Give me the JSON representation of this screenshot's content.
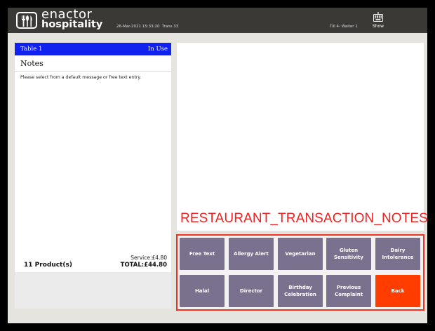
{
  "topbar": {
    "logo_top": "enactor",
    "logo_bottom": "hospitality",
    "date": "26-Mar-2021 15:33:20",
    "trans": "Trans 33",
    "till": "Till 4- Waiter 1",
    "show_label": "Show"
  },
  "left_panel": {
    "table_name": "Table 1",
    "table_status": "In Use",
    "notes_title": "Notes",
    "notes_message": "Please select from a default message or free text entry.",
    "service": "Service:£4.80",
    "products": "11 Product(s)",
    "total": "TOTAL:£44.80"
  },
  "right_panel": {
    "screen_code": "RESTAURANT_TRANSACTION_NOTES"
  },
  "buttons": {
    "free_text": "Free Text",
    "allergy_alert": "Allergy Alert",
    "vegetarian": "Vegetarian",
    "gluten": "Gluten Sensitivity",
    "dairy": "Dairy Intolerance",
    "halal": "Halal",
    "director": "Director",
    "birthday": "Birthday Celebration",
    "previous_complaint": "Previous Complaint",
    "back": "Back"
  },
  "colors": {
    "topbar": "#3b3936",
    "header_blue": "#1122ee",
    "button_purple": "#7a718e",
    "back_orange": "#ff3d00",
    "highlight_red": "#ee3322"
  },
  "icons": {
    "logo": "cutlery-logo-icon",
    "show": "keyboard-icon"
  }
}
